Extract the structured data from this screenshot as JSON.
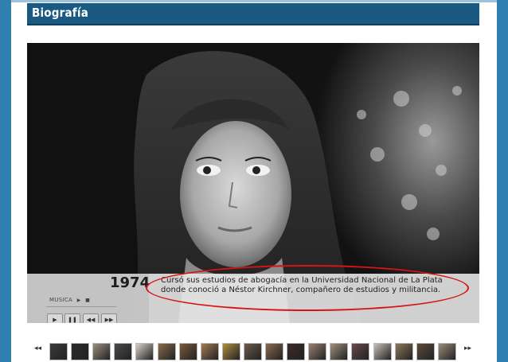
{
  "section": {
    "title": "Biografía"
  },
  "slide": {
    "year": "1974",
    "caption": "Cursó sus estudios de abogacía en la Universidad Nacional de La Plata donde conoció a Néstor Kirchner, compañero de estudios y militancia."
  },
  "controls": {
    "music_label": "MUSICA",
    "music_play_glyph": "▶",
    "music_stop_glyph": "■",
    "play_glyph": "▶",
    "pause_glyph": "❚❚",
    "prev_glyph": "◀◀",
    "next_glyph": "▶▶"
  },
  "filmstrip": {
    "prev_glyph": "◂◂",
    "next_glyph": "▸▸",
    "thumbnails": [
      {
        "color": "#3b3b3b"
      },
      {
        "color": "#2b2b2b"
      },
      {
        "color": "#9a8f80"
      },
      {
        "color": "#4a4a4a"
      },
      {
        "color": "#d8d2c8"
      },
      {
        "color": "#8a6a4a"
      },
      {
        "color": "#7a5a3a"
      },
      {
        "color": "#a07a50"
      },
      {
        "color": "#b08e40"
      },
      {
        "color": "#6a5a4a"
      },
      {
        "color": "#8a6a50"
      },
      {
        "color": "#3a2a2a"
      },
      {
        "color": "#9a8070"
      },
      {
        "color": "#a09080"
      },
      {
        "color": "#6a4a4a"
      },
      {
        "color": "#c8c0b8"
      },
      {
        "color": "#8a7a5a"
      },
      {
        "color": "#5a4a3a"
      },
      {
        "color": "#9a8a7a"
      }
    ]
  },
  "colors": {
    "accent": "#1a5a82",
    "highlight": "#d61414",
    "outer": "#2f7fb0"
  }
}
